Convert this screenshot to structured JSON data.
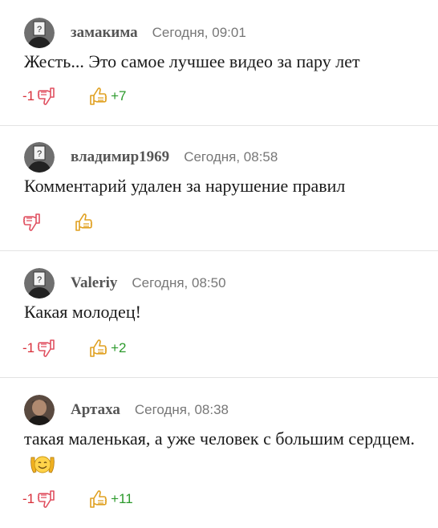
{
  "comments": [
    {
      "author": "замакима",
      "time": "Сегодня, 09:01",
      "text": "Жесть... Это самое лучшее видео за пару лет",
      "down": "-1",
      "up": "+7",
      "avatar": "placeholder-avatar"
    },
    {
      "author": "владимир1969",
      "time": "Сегодня, 08:58",
      "text": "Комментарий удален за нарушение правил",
      "down": "",
      "up": "",
      "avatar": "placeholder-avatar"
    },
    {
      "author": "Valeriy",
      "time": "Сегодня, 08:50",
      "text": "Какая молодец!",
      "down": "-1",
      "up": "+2",
      "avatar": "placeholder-avatar"
    },
    {
      "author": "Артаха",
      "time": "Сегодня, 08:38",
      "text": "такая маленькая, а уже человек с большим сердцем.",
      "down": "-1",
      "up": "+11",
      "avatar": "photo-avatar",
      "emoji": "praying-smile-emoji"
    }
  ],
  "colors": {
    "negative": "#d8303a",
    "positive": "#2c9a2c",
    "thumb_down": "#e05060",
    "thumb_up": "#e0a020"
  },
  "icons": {
    "thumb_down": "thumb-down-icon",
    "thumb_up": "thumb-up-icon"
  }
}
